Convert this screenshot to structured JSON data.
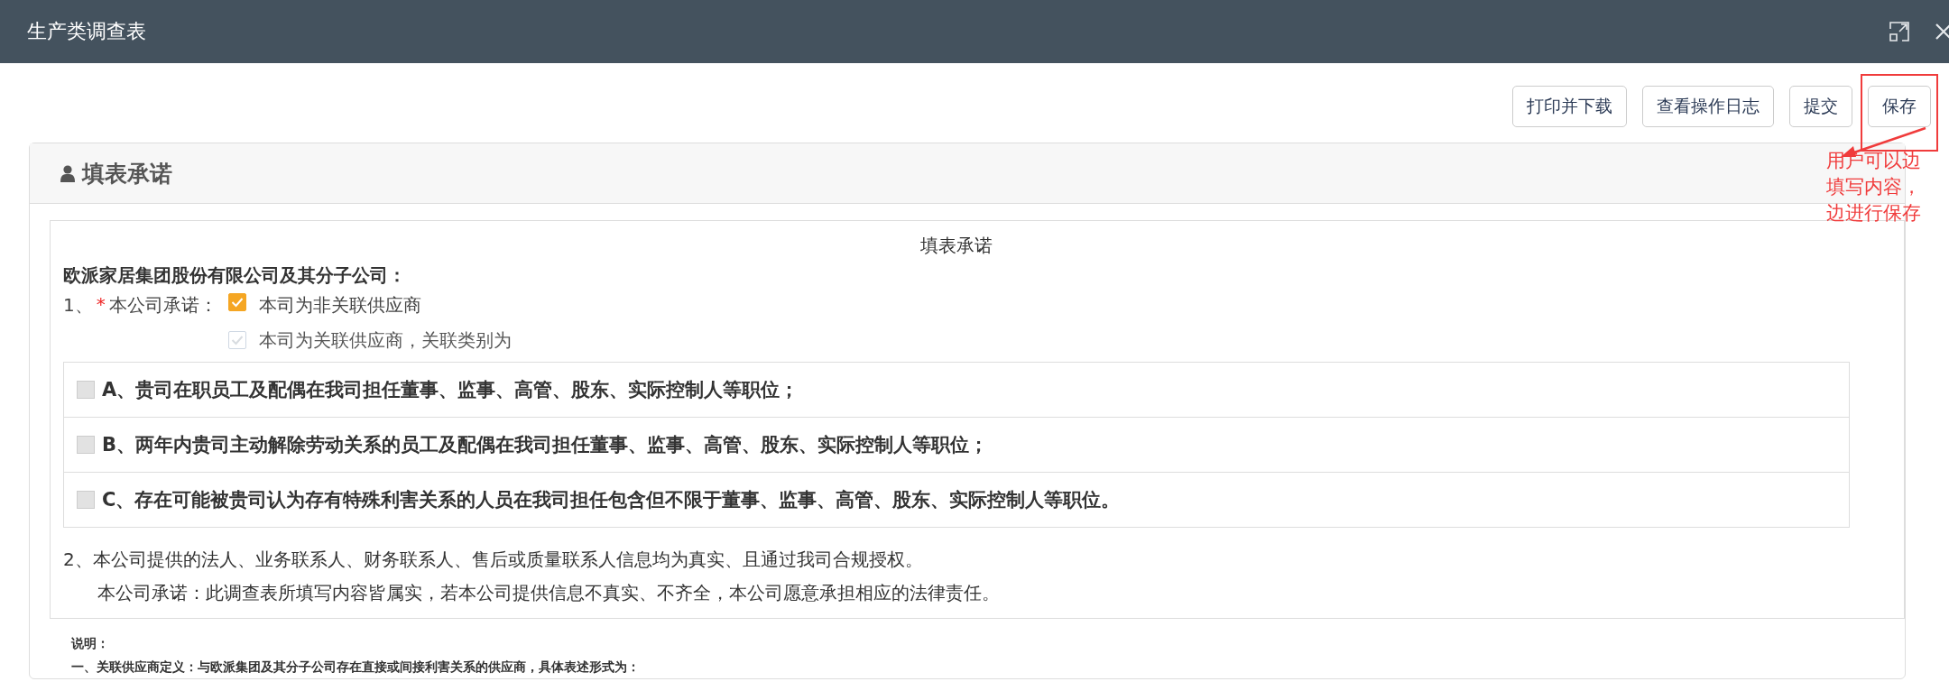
{
  "window": {
    "title": "生产类调查表"
  },
  "toolbar": {
    "buttons": [
      "打印并下载",
      "查看操作日志",
      "提交",
      "保存"
    ]
  },
  "annotation": {
    "text_lines": [
      "用户可以边",
      "填写内容，",
      "边进行保存"
    ]
  },
  "panel": {
    "title": "填表承诺",
    "form_title": "填表承诺",
    "addressee": "欧派家居集团股份有限公司及其分子公司：",
    "item_1": {
      "number": "1、",
      "required_mark": "*",
      "label": "本公司承诺：",
      "options": [
        {
          "label": "本司为非关联供应商",
          "checked": true,
          "disabled": false
        },
        {
          "label": "本司为关联供应商，关联类别为",
          "checked": false,
          "disabled": true
        }
      ],
      "categories": [
        {
          "label": "A、贵司在职员工及配偶在我司担任董事、监事、高管、股东、实际控制人等职位；",
          "checked": false
        },
        {
          "label": "B、两年内贵司主动解除劳动关系的员工及配偶在我司担任董事、监事、高管、股东、实际控制人等职位；",
          "checked": false
        },
        {
          "label": "C、存在可能被贵司认为存有特殊利害关系的人员在我司担任包含但不限于董事、监事、高管、股东、实际控制人等职位。",
          "checked": false
        }
      ]
    },
    "item_2": {
      "text": "2、本公司提供的法人、业务联系人、财务联系人、售后或质量联系人信息均为真实、且通过我司合规授权。",
      "pledge": "本公司承诺：此调查表所填写内容皆属实，若本公司提供信息不真实、不齐全，本公司愿意承担相应的法律责任。"
    }
  },
  "notes": {
    "heading": "说明：",
    "lines": [
      "一、关联供应商定义：与欧派集团及其分子公司存在直接或间接利害关系的供应商，具体表述形式为："
    ]
  }
}
